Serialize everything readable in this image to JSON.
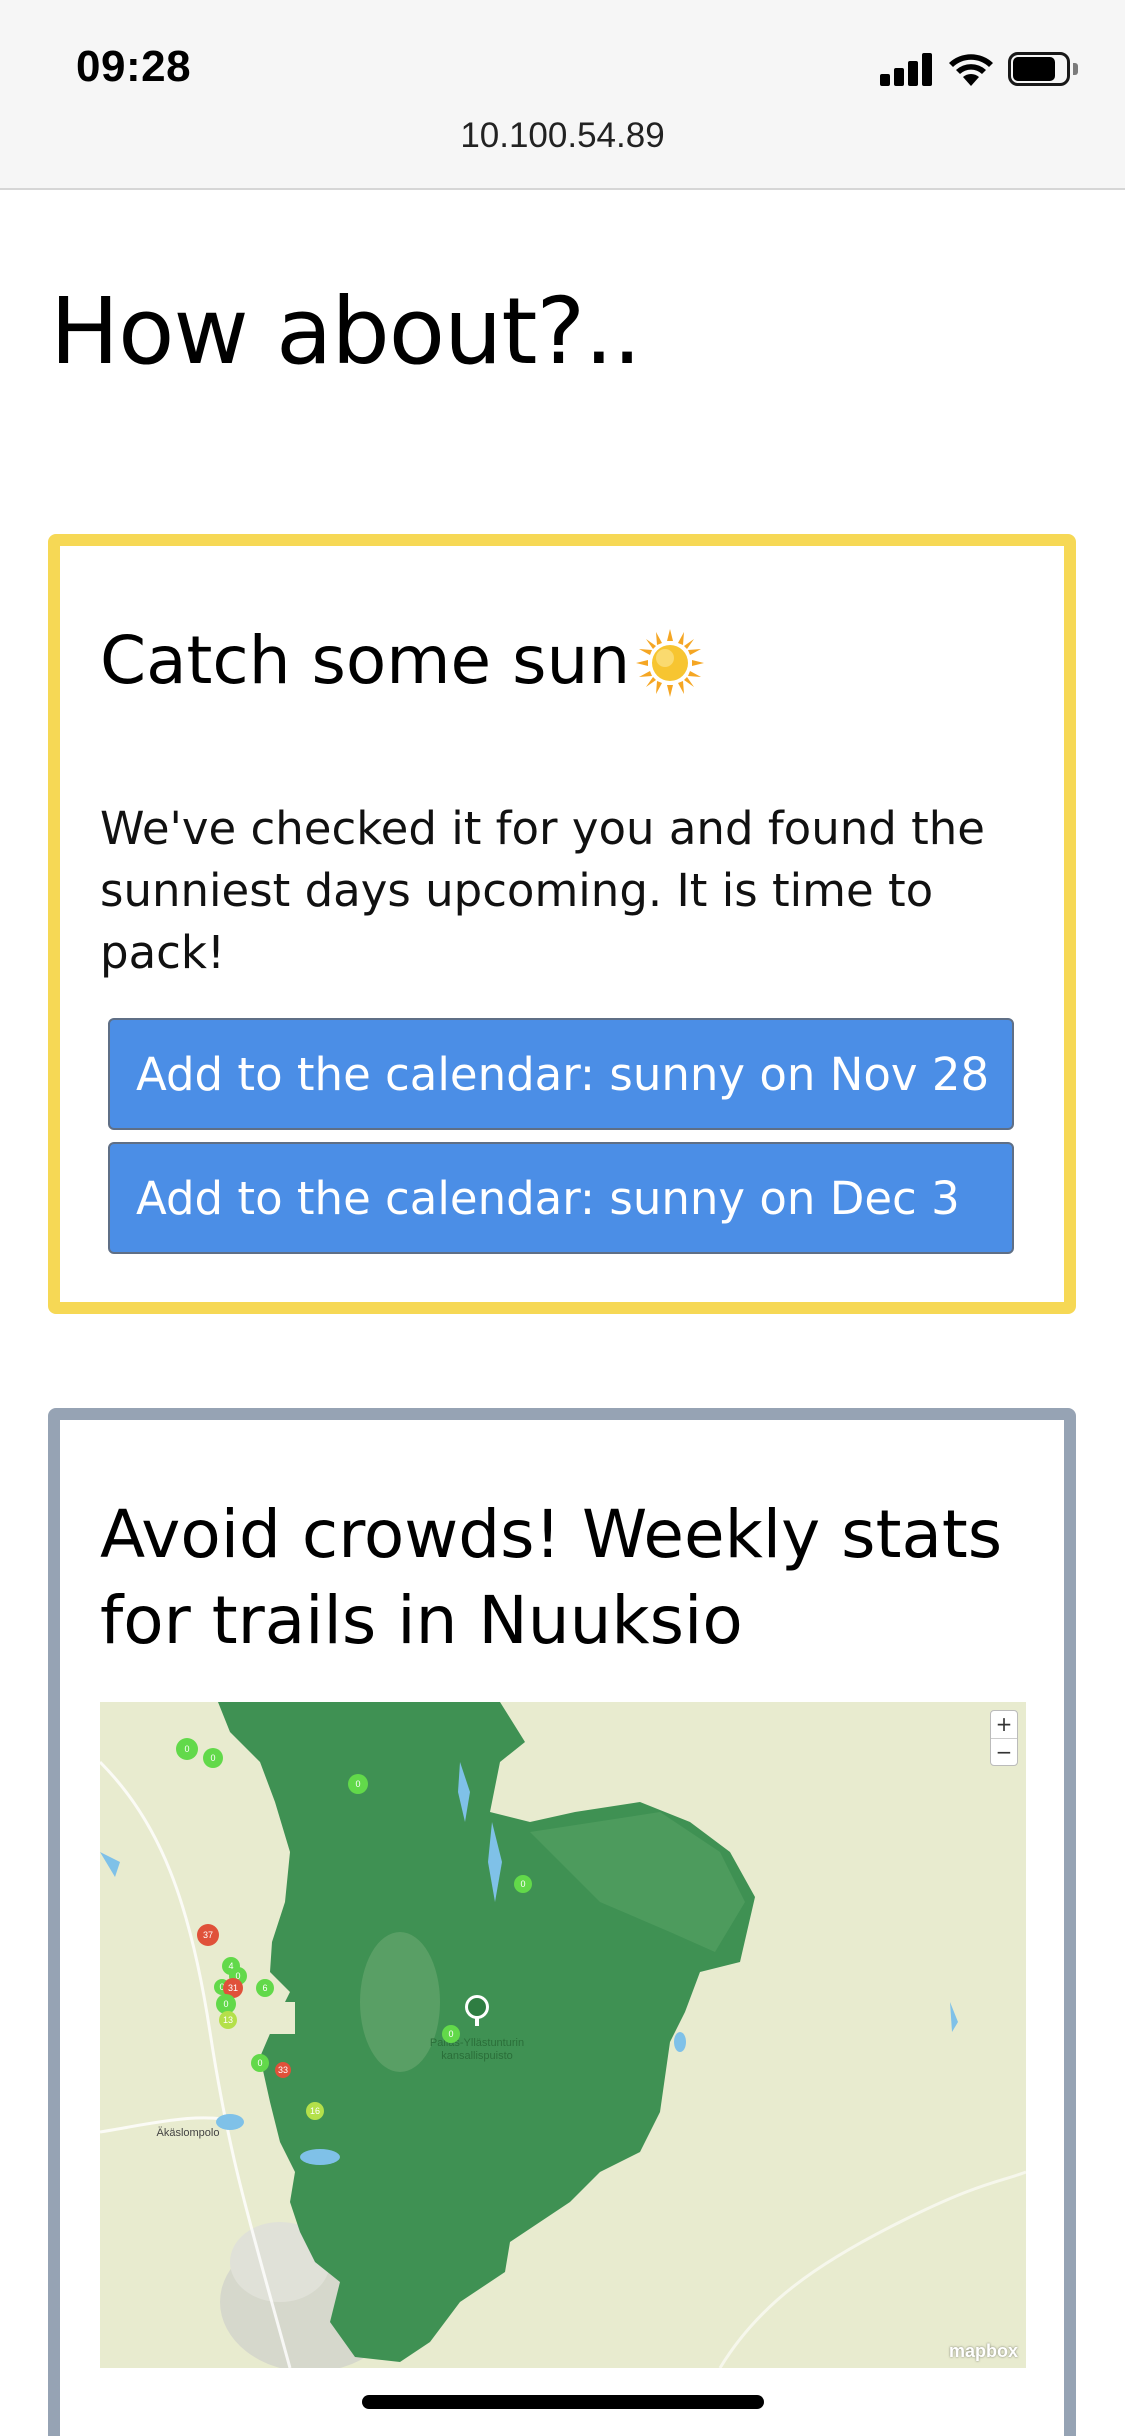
{
  "status_bar": {
    "time": "09:28",
    "url": "10.100.54.89"
  },
  "page": {
    "title": "How about?.."
  },
  "sun_card": {
    "title": "Catch some sun",
    "body": "We've checked it for you and found the sunniest days upcoming. It is time to pack!",
    "buttons": [
      {
        "label": "Add to the calendar: sunny on Nov 28"
      },
      {
        "label": "Add to the calendar: sunny on Dec 3"
      }
    ],
    "border_color": "#f6d855"
  },
  "crowd_card": {
    "title": "Avoid crowds! Weekly stats for trails in Nuuksio",
    "border_color": "#96a3b4",
    "map": {
      "park_label_line1": "Pallas-Yllästunturin",
      "park_label_line2": "kansallispuisto",
      "place_label": "Äkäslompolo",
      "zoom_in": "+",
      "zoom_out": "−",
      "attribution": "mapbox",
      "markers": [
        {
          "count": "0",
          "status": "low"
        },
        {
          "count": "0",
          "status": "low"
        },
        {
          "count": "0",
          "status": "low"
        },
        {
          "count": "0",
          "status": "low"
        },
        {
          "count": "37",
          "status": "high"
        },
        {
          "count": "4",
          "status": "low"
        },
        {
          "count": "0",
          "status": "low"
        },
        {
          "count": "0",
          "status": "low"
        },
        {
          "count": "31",
          "status": "high"
        },
        {
          "count": "6",
          "status": "low"
        },
        {
          "count": "0",
          "status": "low"
        },
        {
          "count": "13",
          "status": "medium"
        },
        {
          "count": "0",
          "status": "low"
        },
        {
          "count": "0",
          "status": "low"
        },
        {
          "count": "33",
          "status": "high"
        },
        {
          "count": "16",
          "status": "medium"
        }
      ],
      "colors": {
        "low": "#62d94a",
        "medium": "#b4e04a",
        "high": "#e0513a",
        "park": "#3f9153",
        "land": "#e8ebcf",
        "water": "#7fc1e8"
      }
    }
  }
}
